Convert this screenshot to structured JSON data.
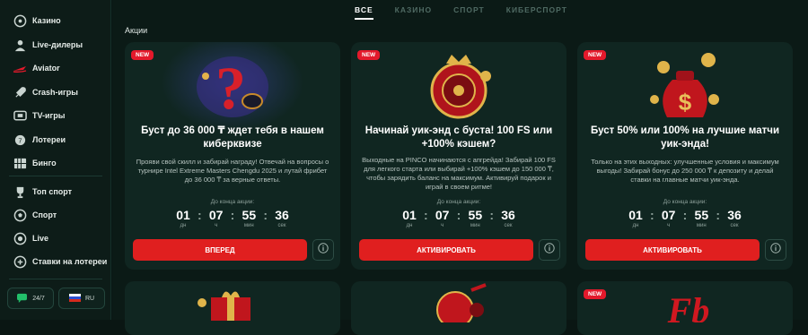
{
  "sidebar": {
    "items": [
      {
        "label": "Казино",
        "icon": "casino-icon"
      },
      {
        "label": "Live-дилеры",
        "icon": "live-dealer-icon"
      },
      {
        "label": "Aviator",
        "icon": "aviator-icon"
      },
      {
        "label": "Crash-игры",
        "icon": "rocket-icon"
      },
      {
        "label": "TV-игры",
        "icon": "tv-icon"
      },
      {
        "label": "Лотереи",
        "icon": "lottery-icon"
      },
      {
        "label": "Бинго",
        "icon": "bingo-icon"
      },
      {
        "label": "Топ спорт",
        "icon": "trophy-icon"
      },
      {
        "label": "Спорт",
        "icon": "soccer-ball-icon"
      },
      {
        "label": "Live",
        "icon": "live-icon"
      },
      {
        "label": "Ставки на лотереи",
        "icon": "lottery-bet-icon"
      }
    ],
    "support_label": "24/7",
    "language_label": "RU"
  },
  "tabs": [
    "ВСЕ",
    "КАЗИНО",
    "СПОРТ",
    "КИБЕРСПОРТ"
  ],
  "active_tab": "ВСЕ",
  "section_title": "Акции",
  "countdown_label": "До конца акции:",
  "cards": [
    {
      "badge": "NEW",
      "title": "Буст до 36 000 ₸ ждет тебя в нашем киберквизе",
      "description": "Прояви свой скилл и забирай награду! Отвечай на вопросы о турнире Intel Extreme Masters Chengdu 2025 и лутай фрибет до 36 000 ₸ за верные ответы.",
      "countdown": {
        "days": "01",
        "hours": "07",
        "minutes": "55",
        "seconds": "36",
        "days_label": "дн",
        "hours_label": "ч",
        "minutes_label": "мин",
        "seconds_label": "сек"
      },
      "button": "ВПЕРЕД"
    },
    {
      "badge": "NEW",
      "title": "Начинай уик-энд с буста! 100 FS или +100% кэшем?",
      "description": "Выходные на PINCO начинаются с апгрейда! Забирай 100 FS для легкого старта или выбирай +100% кэшем до 150 000 ₸, чтобы зарядить баланс на максимум. Активируй подарок и играй в своем ритме!",
      "countdown": {
        "days": "01",
        "hours": "07",
        "minutes": "55",
        "seconds": "36",
        "days_label": "дн",
        "hours_label": "ч",
        "minutes_label": "мин",
        "seconds_label": "сек"
      },
      "button": "АКТИВИРОВАТЬ"
    },
    {
      "badge": "NEW",
      "title": "Буст 50% или 100% на лучшие матчи уик-энда!",
      "description": "Только на этих выходных: улучшенные условия и максимум выгоды! Забирай бонус до 250 000 ₸ к депозиту и делай ставки на главные матчи уик-энда.",
      "countdown": {
        "days": "01",
        "hours": "07",
        "minutes": "55",
        "seconds": "36",
        "days_label": "дн",
        "hours_label": "ч",
        "minutes_label": "мин",
        "seconds_label": "сек"
      },
      "button": "АКТИВИРОВАТЬ"
    }
  ],
  "second_row_badge": "NEW",
  "colors": {
    "accent_red": "#e01f1f",
    "badge_red": "#e3192b",
    "card_bg": "#102621",
    "page_bg": "#0b1a16"
  }
}
